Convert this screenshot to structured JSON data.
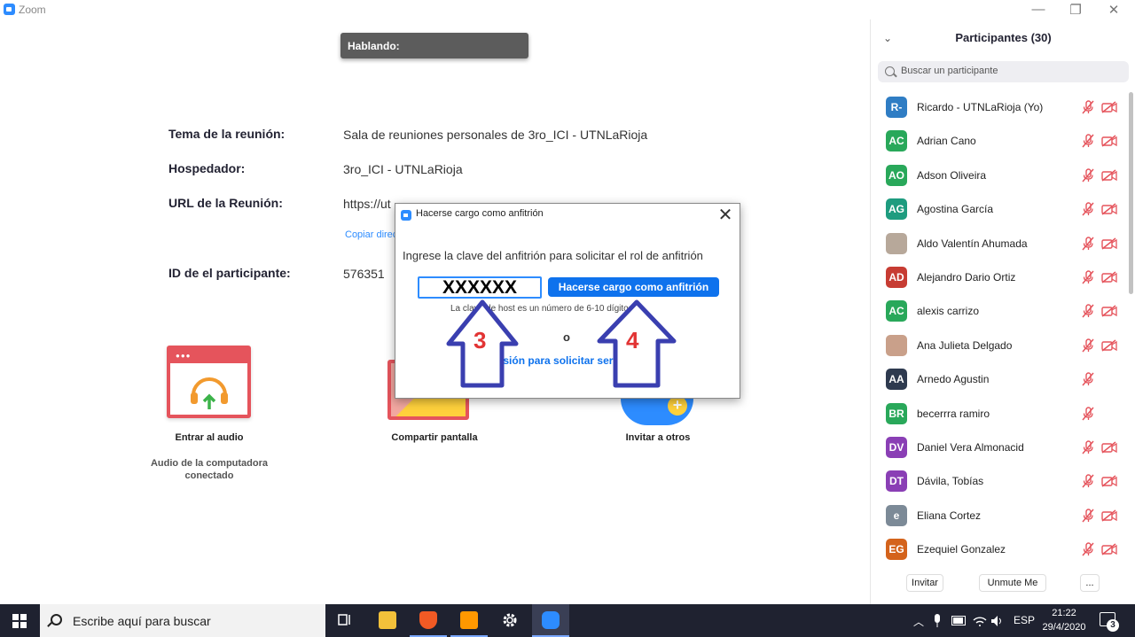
{
  "window": {
    "app_title": "Zoom",
    "minimize": "—",
    "restore": "❐",
    "close": "✕"
  },
  "speaking": {
    "label": "Hablando:"
  },
  "meeting": {
    "topic_label": "Tema de la reunión:",
    "topic_value": "Sala de reuniones personales de 3ro_ICI - UTNLaRioja",
    "host_label": "Hospedador:",
    "host_value": "3ro_ICI - UTNLaRioja",
    "url_label": "URL de la Reunión:",
    "url_value": "https://ut",
    "copy_link": "Copiar direc",
    "participant_id_label": "ID de el participante:",
    "participant_id_value": "576351"
  },
  "actions": {
    "audio_label": "Entrar al audio",
    "audio_sub": "Audio de la computadora conectado",
    "share_label": "Compartir pantalla",
    "invite_label": "Invitar a otros"
  },
  "dialog": {
    "title": "Hacerse cargo como anfitrión",
    "close": "✕",
    "prompt": "Ingrese la clave del anfitrión para solicitar el rol de anfitrión",
    "input_value": "XXXXXX",
    "button": "Hacerse cargo como anfitrión",
    "hint": "La clave de host es un número de 6-10 dígitos",
    "or": "o",
    "signin": "Inicie sesión para solicitar ser anfitrión"
  },
  "annotations": {
    "arrow_3": "3",
    "arrow_4": "4",
    "color": "#3a3fb0",
    "number_color": "#e23434"
  },
  "participants_panel": {
    "collapse": "⌄",
    "title": "Participantes (30)",
    "search_placeholder": "Buscar un participante",
    "items": [
      {
        "initials": "R-",
        "name": "Ricardo - UTNLaRioja (Yo)",
        "color": "#2f7dc4",
        "cam_icon": true
      },
      {
        "initials": "AC",
        "name": "Adrian Cano",
        "color": "#29a85a",
        "cam_icon": true
      },
      {
        "initials": "AO",
        "name": "Adson Oliveira",
        "color": "#29a85a",
        "cam_icon": true
      },
      {
        "initials": "AG",
        "name": "Agostina García",
        "color": "#1e9c7f",
        "cam_icon": true
      },
      {
        "initials": "",
        "name": "Aldo Valentín Ahumada",
        "color": "#b7a89a",
        "cam_icon": true
      },
      {
        "initials": "AD",
        "name": "Alejandro Dario Ortiz",
        "color": "#c73c33",
        "cam_icon": true
      },
      {
        "initials": "AC",
        "name": "alexis carrizo",
        "color": "#29a85a",
        "cam_icon": true
      },
      {
        "initials": "",
        "name": "Ana Julieta Delgado",
        "color": "#c9a08a",
        "cam_icon": true
      },
      {
        "initials": "AA",
        "name": "Arnedo Agustin",
        "color": "#2e3a4f",
        "cam_icon": false
      },
      {
        "initials": "BR",
        "name": "becerrra ramiro",
        "color": "#29a85a",
        "cam_icon": false
      },
      {
        "initials": "DV",
        "name": "Daniel Vera Almonacid",
        "color": "#8a3fb5",
        "cam_icon": true
      },
      {
        "initials": "DT",
        "name": "Dávila, Tobías",
        "color": "#8a3fb5",
        "cam_icon": true
      },
      {
        "initials": "e",
        "name": "Eliana Cortez",
        "color": "#7c8a97",
        "cam_icon": true
      },
      {
        "initials": "EG",
        "name": "Ezequiel Gonzalez",
        "color": "#d4631c",
        "cam_icon": true
      }
    ],
    "footer": {
      "invite": "Invitar",
      "unmute": "Unmute Me",
      "more": "..."
    }
  },
  "taskbar": {
    "search_placeholder": "Escribe aquí para buscar",
    "lang": "ESP",
    "time": "21:22",
    "date": "29/4/2020",
    "notifications": "3"
  }
}
